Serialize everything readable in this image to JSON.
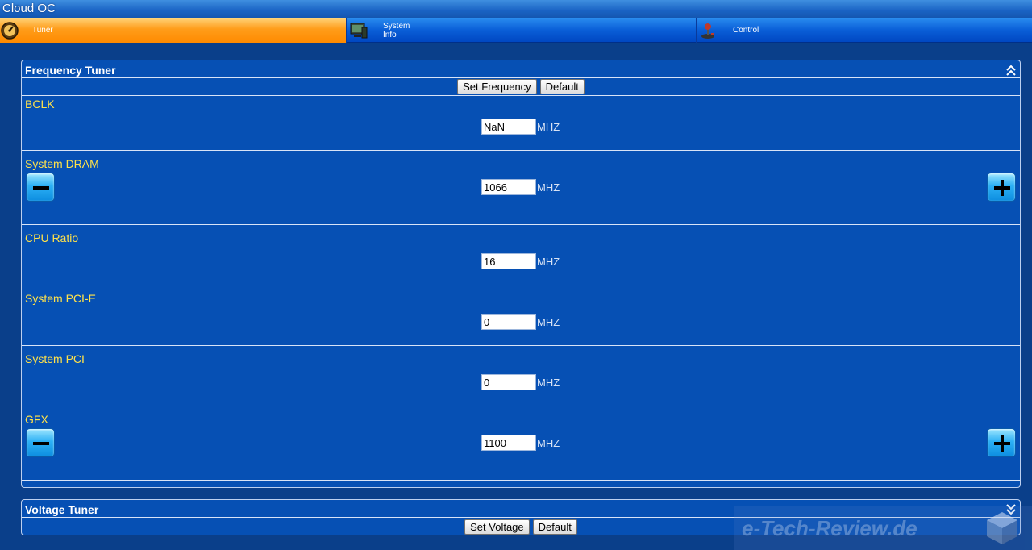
{
  "window": {
    "title": "Cloud OC"
  },
  "tabs": [
    {
      "label": "Tuner",
      "icon": "gauge-icon",
      "active": true
    },
    {
      "label": "System Info",
      "label_line1": "System",
      "label_line2": "Info",
      "icon": "monitor-icon",
      "active": false
    },
    {
      "label": "Control",
      "icon": "joystick-icon",
      "active": false
    }
  ],
  "frequency_tuner": {
    "title": "Frequency Tuner",
    "set_button": "Set Frequency",
    "default_button": "Default",
    "rows": [
      {
        "label": "BCLK",
        "value": "NaN",
        "unit": "MHZ",
        "has_steppers": false
      },
      {
        "label": "System DRAM",
        "value": "1066",
        "unit": "MHZ",
        "has_steppers": true
      },
      {
        "label": "CPU Ratio",
        "value": "16",
        "unit": "MHZ",
        "has_steppers": false
      },
      {
        "label": "System PCI-E",
        "value": "0",
        "unit": "MHZ",
        "has_steppers": false
      },
      {
        "label": "System PCI",
        "value": "0",
        "unit": "MHZ",
        "has_steppers": false
      },
      {
        "label": "GFX",
        "value": "1100",
        "unit": "MHZ",
        "has_steppers": true
      }
    ]
  },
  "voltage_tuner": {
    "title": "Voltage Tuner",
    "set_button": "Set Voltage",
    "default_button": "Default"
  },
  "watermark": {
    "text": "e-Tech-Review.de"
  },
  "colors": {
    "background": "#0a3f8a",
    "panel": "#0650b4",
    "label": "#ffe24a",
    "active_tab": "#ff9d1a"
  }
}
